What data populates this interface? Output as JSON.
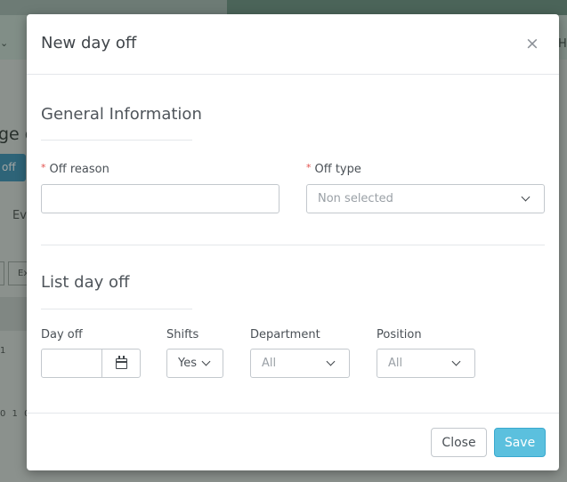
{
  "background": {
    "heading_fragment": "ge o",
    "button_fragment": "off",
    "tab_fragment": "Ev",
    "small_button_fragment": "Ex",
    "nav_right_fragment": "H",
    "cell_fragment_1": "1",
    "cell_fragment_2": "0 1 0",
    "nav_chevron": "⌄"
  },
  "modal": {
    "title": "New day off",
    "close_icon": "×",
    "general_section": {
      "title": "General Information",
      "off_reason": {
        "label": "Off reason",
        "required_mark": "*",
        "value": "",
        "placeholder": ""
      },
      "off_type": {
        "label": "Off type",
        "required_mark": "*",
        "selected": "Non selected"
      }
    },
    "list_section": {
      "title": "List day off",
      "day_off": {
        "label": "Day off",
        "value": ""
      },
      "shifts": {
        "label": "Shifts",
        "selected": "Yes"
      },
      "department": {
        "label": "Department",
        "selected": "All"
      },
      "position": {
        "label": "Position",
        "selected": "All"
      }
    },
    "footer": {
      "close_label": "Close",
      "save_label": "Save"
    }
  },
  "colors": {
    "primary_button": "#5bc0de",
    "required_mark": "#e2504c",
    "overlay": "rgba(30,40,35,0.42)"
  },
  "icons": {
    "close": "close-icon",
    "calendar": "calendar-icon",
    "dropdown": "chevron-down-icon"
  }
}
